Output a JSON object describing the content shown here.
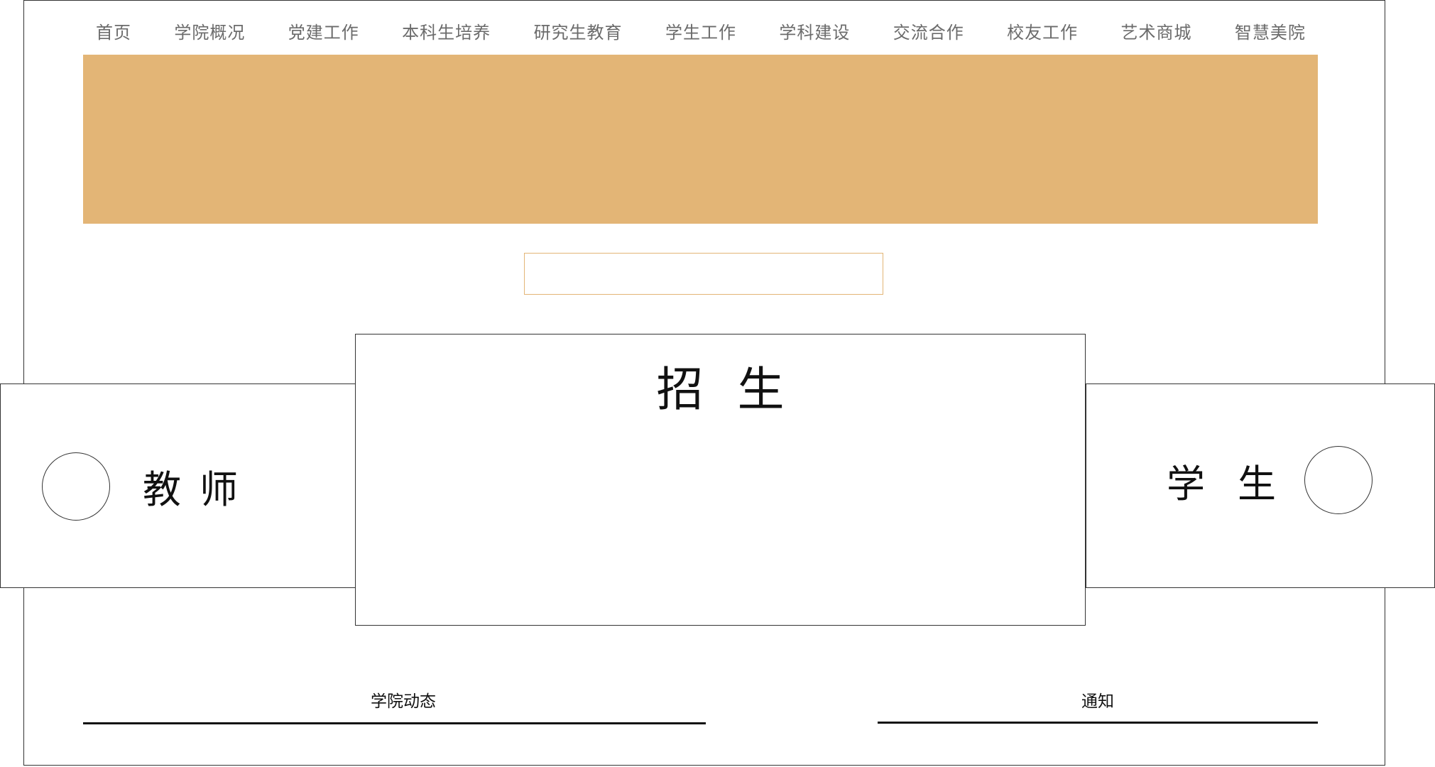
{
  "nav": {
    "items": [
      {
        "label": "首页"
      },
      {
        "label": "学院概况"
      },
      {
        "label": "党建工作"
      },
      {
        "label": "本科生培养"
      },
      {
        "label": "研究生教育"
      },
      {
        "label": "学生工作"
      },
      {
        "label": "学科建设"
      },
      {
        "label": "交流合作"
      },
      {
        "label": "校友工作"
      },
      {
        "label": "艺术商城"
      },
      {
        "label": "智慧美院"
      }
    ]
  },
  "banner": {
    "color": "#e3b576"
  },
  "search": {
    "value": "",
    "placeholder": ""
  },
  "cards": {
    "teacher": {
      "title": "教师"
    },
    "admission": {
      "title": "招生"
    },
    "student": {
      "title": "学生"
    }
  },
  "sections": {
    "news": {
      "title": "学院动态"
    },
    "notice": {
      "title": "通知"
    }
  }
}
